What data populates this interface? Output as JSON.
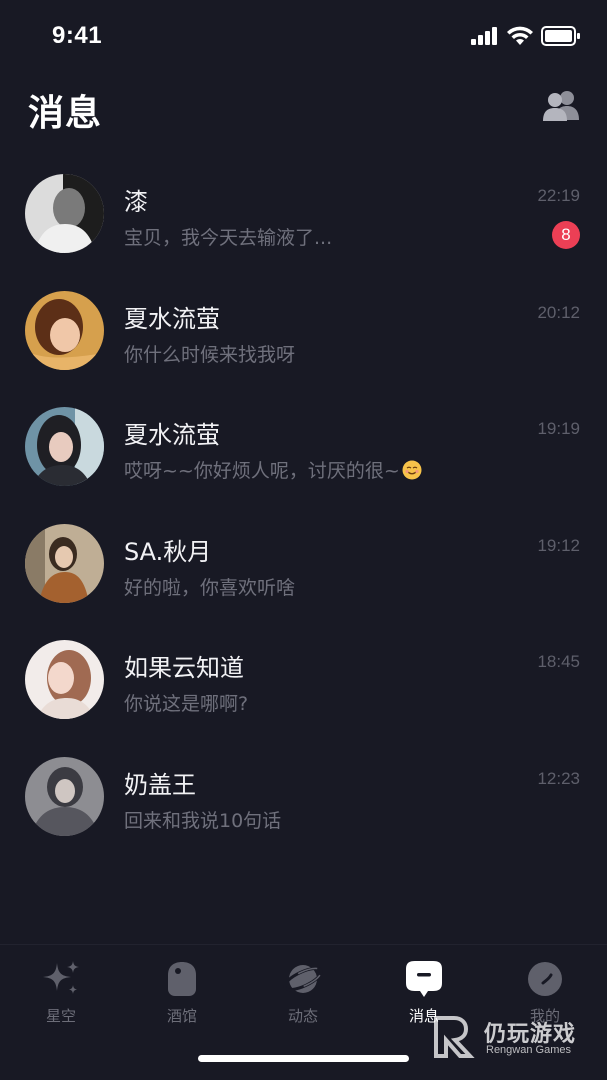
{
  "status_bar": {
    "time": "9:41"
  },
  "header": {
    "title": "消息",
    "contacts_icon": "people-icon"
  },
  "conversations": [
    {
      "name": "漆",
      "preview": "宝贝，我今天去输液了...",
      "time": "22:19",
      "unread": "8",
      "avatar_colors": [
        "#d8d8d8",
        "#2a2a2a"
      ]
    },
    {
      "name": "夏水流萤",
      "preview": "你什么时候来找我呀",
      "time": "20:12",
      "unread": null,
      "avatar_colors": [
        "#d9a65a",
        "#6b3b1f"
      ]
    },
    {
      "name": "夏水流萤",
      "preview": "哎呀~~你好烦人呢，讨厌的很~",
      "time": "19:19",
      "unread": null,
      "avatar_colors": [
        "#7fa5b8",
        "#2b2e35"
      ]
    },
    {
      "name": "SA.秋月",
      "preview": "好的啦，你喜欢听啥",
      "time": "19:12",
      "unread": null,
      "avatar_colors": [
        "#c8b59a",
        "#6e5a44"
      ]
    },
    {
      "name": "如果云知道",
      "preview": "你说这是哪啊?",
      "time": "18:45",
      "unread": null,
      "avatar_colors": [
        "#f0e6e2",
        "#a7705a"
      ]
    },
    {
      "name": "奶盖王",
      "preview": "回来和我说10句话",
      "time": "12:23",
      "unread": null,
      "avatar_colors": [
        "#9a9a9e",
        "#3a3a40"
      ]
    }
  ],
  "tabs": [
    {
      "label": "星空",
      "icon": "sparkle-icon",
      "active": false
    },
    {
      "label": "酒馆",
      "icon": "tavern-icon",
      "active": false
    },
    {
      "label": "动态",
      "icon": "planet-icon",
      "active": false
    },
    {
      "label": "消息",
      "icon": "message-icon",
      "active": true
    },
    {
      "label": "我的",
      "icon": "profile-icon",
      "active": false
    }
  ],
  "watermark": {
    "text": "仍玩游戏",
    "subtext": "Rengwan Games"
  },
  "colors": {
    "background": "#181924",
    "badge": "#ec3f55",
    "muted": "#6f707c"
  }
}
